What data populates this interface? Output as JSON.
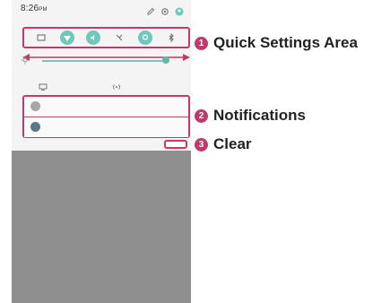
{
  "status_bar": {
    "time": "8:26",
    "ampm": "PM",
    "icons": [
      "edit-icon",
      "settings-icon",
      "account-icon"
    ]
  },
  "quick_settings": {
    "tiles": [
      {
        "icon": "screen-cast-icon",
        "active": false
      },
      {
        "icon": "wifi-icon",
        "active": true
      },
      {
        "icon": "sound-icon",
        "active": true
      },
      {
        "icon": "data-off-icon",
        "active": false
      },
      {
        "icon": "location-icon",
        "active": true
      },
      {
        "icon": "bluetooth-icon",
        "active": false
      }
    ],
    "row2_icons": [
      "screen-share-icon",
      "hotspot-icon"
    ],
    "brightness_level": 0.92
  },
  "notifications": [
    {
      "icon_color": "#a7a7a7"
    },
    {
      "icon_color": "#5b7783"
    }
  ],
  "callouts": [
    {
      "number": "1",
      "label": "Quick Settings Area"
    },
    {
      "number": "2",
      "label": "Notifications"
    },
    {
      "number": "3",
      "label": "Clear"
    }
  ],
  "colors": {
    "accent": "#c0396b",
    "tile_active": "#6fc8b9",
    "phone_bg": "#8f8f8f"
  }
}
